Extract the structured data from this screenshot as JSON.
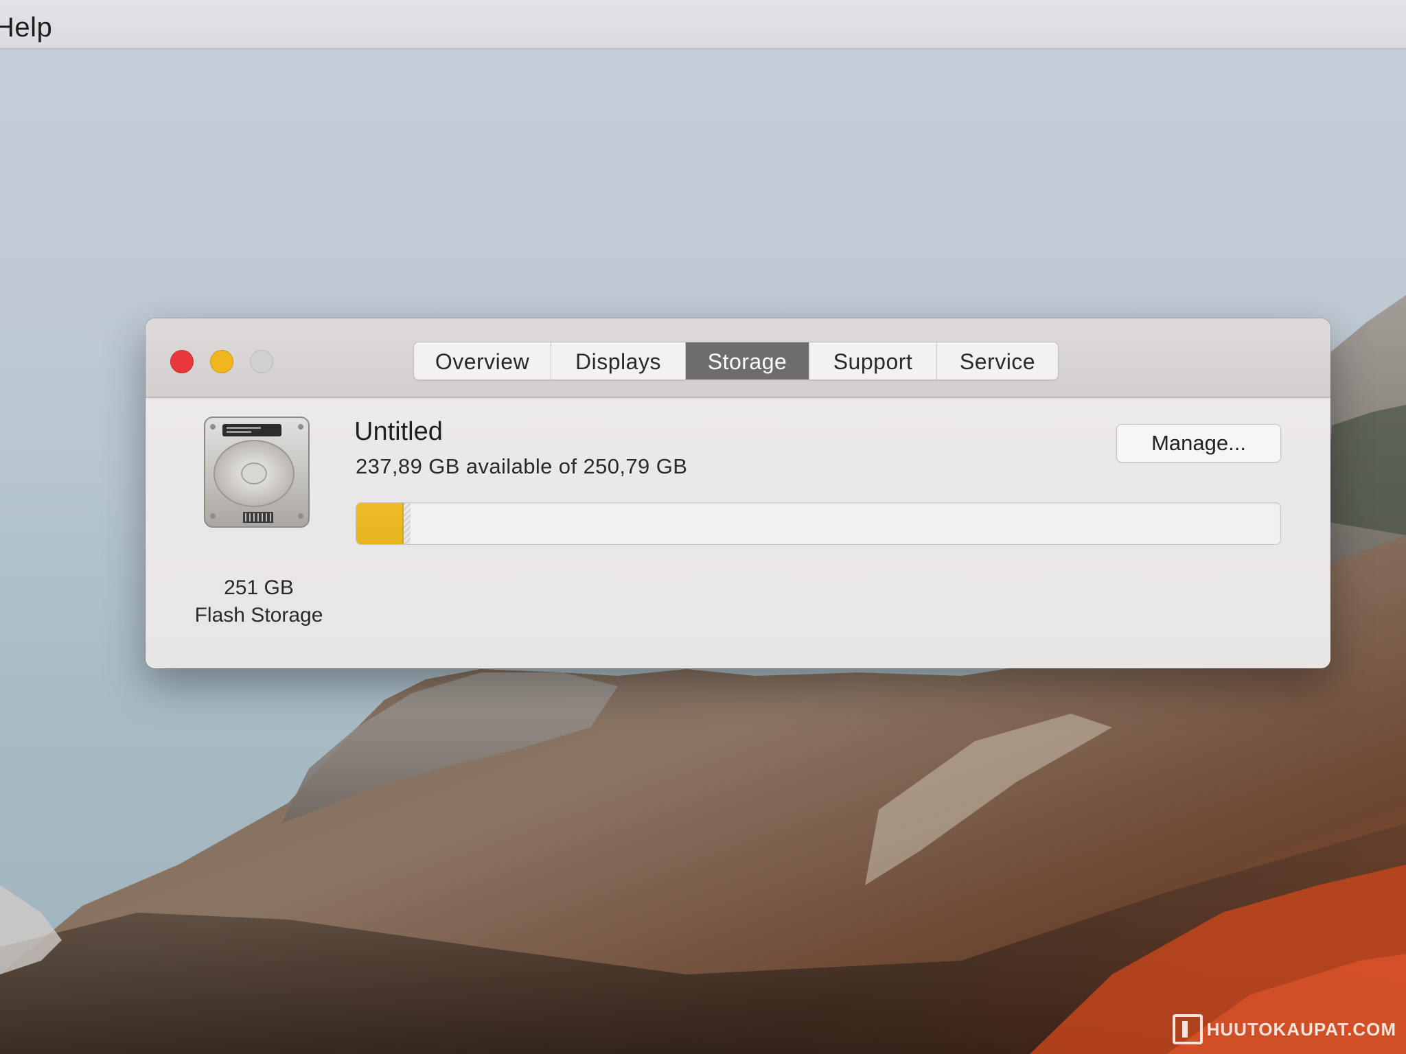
{
  "menubar": {
    "help_label": "Help"
  },
  "window": {
    "controls": {
      "close": "close-control",
      "minimize": "minimize-control",
      "zoom": "zoom-control"
    },
    "tabs": [
      {
        "label": "Overview",
        "active": false
      },
      {
        "label": "Displays",
        "active": false
      },
      {
        "label": "Storage",
        "active": true
      },
      {
        "label": "Support",
        "active": false
      },
      {
        "label": "Service",
        "active": false
      }
    ]
  },
  "storage": {
    "disk_icon": "hard-disk-icon",
    "disk_size": "251 GB",
    "disk_type": "Flash Storage",
    "volume_name": "Untitled",
    "available_text": "237,89 GB available of 250,79 GB",
    "used_fraction": 0.0514,
    "manage_label": "Manage..."
  },
  "watermark": {
    "text": "HUUTOKAUPAT.COM"
  },
  "colors": {
    "used_bar": "#eebd27",
    "active_tab": "#6e6c6d",
    "close": "#e8383d",
    "minimize": "#f0b51f",
    "zoom": "#d2cfcf"
  }
}
